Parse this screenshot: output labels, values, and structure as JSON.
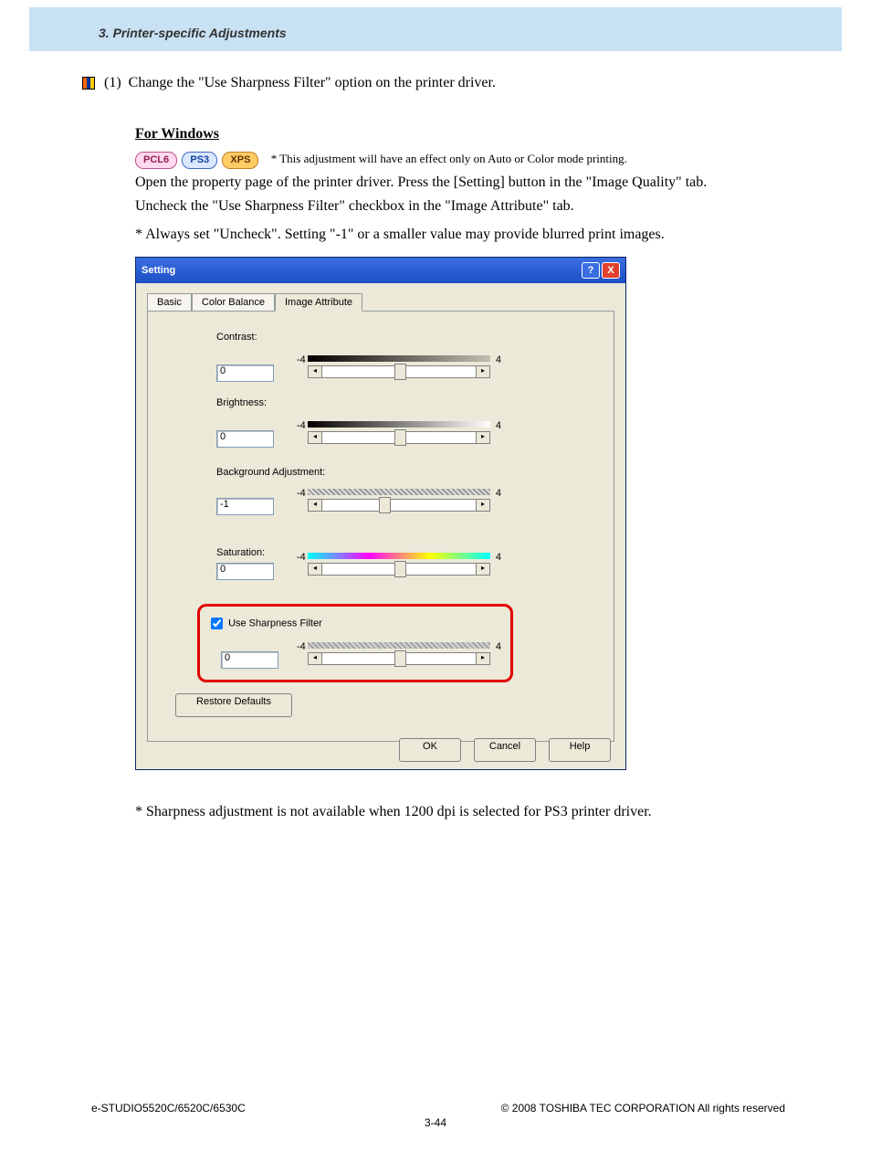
{
  "header": {
    "chapter": "3. Printer-specific Adjustments"
  },
  "step": {
    "num": "(1)",
    "text": "Change the \"Use Sharpness Filter\" option on the printer driver."
  },
  "section": {
    "title": "For Windows"
  },
  "badges": {
    "pcl6": "PCL6",
    "ps3": "PS3",
    "xps": "XPS"
  },
  "badge_note": "* This adjustment will have an effect only on Auto or Color mode printing.",
  "para1": "Open the property page of the printer driver. Press the [Setting] button in the \"Image Quality\" tab.",
  "para2": "Uncheck the \"Use Sharpness Filter\" checkbox in the \"Image Attribute\" tab.",
  "para3": "* Always set \"Uncheck\". Setting \"-1\" or a smaller value may provide blurred print images.",
  "dialog": {
    "title": "Setting",
    "tabs": {
      "basic": "Basic",
      "colorbalance": "Color Balance",
      "imageattribute": "Image Attribute"
    },
    "labels": {
      "contrast": "Contrast:",
      "brightness": "Brightness:",
      "background": "Background Adjustment:",
      "saturation": "Saturation:",
      "sharpness": "Use Sharpness Filter"
    },
    "values": {
      "contrast": "0",
      "brightness": "0",
      "background": "-1",
      "saturation": "0",
      "sharpness": "0"
    },
    "slider_min": "-4",
    "slider_max": "4",
    "restore": "Restore Defaults",
    "ok": "OK",
    "cancel": "Cancel",
    "help": "Help",
    "help_icon": "?",
    "close_icon": "X"
  },
  "footnote": "* Sharpness adjustment is not available when 1200 dpi is selected for PS3 printer driver.",
  "footer": {
    "model": "e-STUDIO5520C/6520C/6530C",
    "copyright": "© 2008 TOSHIBA TEC CORPORATION All rights reserved",
    "page": "3-44"
  }
}
